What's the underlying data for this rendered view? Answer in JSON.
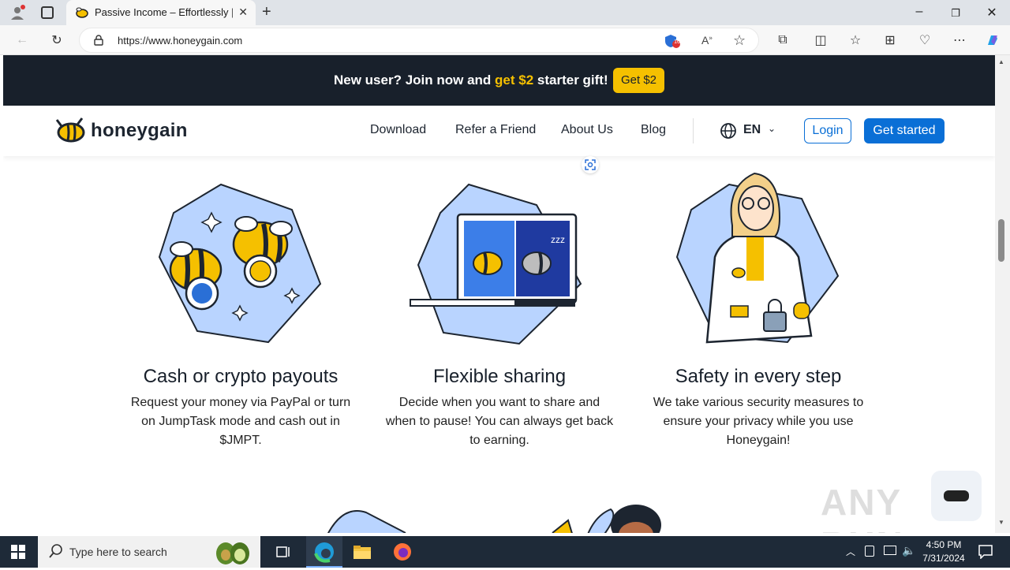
{
  "browser": {
    "tab_title": "Passive Income – Effortlessly | Ho",
    "url": "https://www.honeygain.com",
    "extension_badge": "16"
  },
  "promo": {
    "text_prefix": "New user? Join now and ",
    "highlight": "get $2",
    "text_suffix": " starter gift!",
    "button_label": "Get $2"
  },
  "nav": {
    "logo": "honeygain",
    "links": [
      "Download",
      "Refer a Friend",
      "About Us",
      "Blog"
    ],
    "language": "EN",
    "login_label": "Login",
    "cta_label": "Get started"
  },
  "features": [
    {
      "title": "Cash or crypto payouts",
      "desc": "Request your money via PayPal or turn on JumpTask mode and cash out in $JMPT."
    },
    {
      "title": "Flexible sharing",
      "desc": "Decide when you want to share and when to pause! You can always get back to earning."
    },
    {
      "title": "Safety in every step",
      "desc": "We take various security measures to ensure your privacy while you use Honeygain!"
    }
  ],
  "taskbar": {
    "search_placeholder": "Type here to search",
    "time": "4:50 PM",
    "date": "7/31/2024"
  },
  "watermark": "ANY RUN",
  "colors": {
    "promo_bg": "#18202b",
    "brand_gold": "#f5c000",
    "brand_blue": "#0a6fd6",
    "illustration_bg": "#b9d4ff"
  }
}
